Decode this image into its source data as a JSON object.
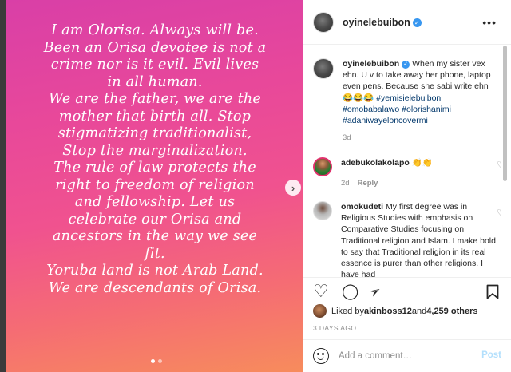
{
  "post": {
    "quote_lines": [
      "I am Olorisa. Always will be.",
      "Been an Orisa devotee is not a",
      "crime nor is it evil. Evil lives",
      "in all human.",
      "We are the father, we are the",
      "mother that birth all. Stop",
      "stigmatizing traditionalist,",
      "Stop the marginalization.",
      "The rule of law protects the",
      "right to freedom of religion",
      "and fellowship. Let us",
      "celebrate our Orisa and",
      "ancestors in the way we see",
      "fit.",
      "Yoruba land is not Arab Land.",
      "We are descendants of Orisa."
    ],
    "next_icon": "›",
    "carousel_index": 1,
    "carousel_count": 2
  },
  "header": {
    "username": "oyinelebuibon",
    "verified_icon": "✓",
    "more_icon": "•••"
  },
  "caption": {
    "username": "oyinelebuibon",
    "text": " When my sister vex ehn. U v to take away her phone, laptop even pens. Because she sabi write ehn 😂😂😂 ",
    "hashtags": "#yemisielebuibon #omobabalawo #olorishanimi #adaniwayeloncovermi",
    "age": "3d"
  },
  "comments": [
    {
      "username": "adebukolakolapo",
      "text": " 👏👏",
      "age": "2d",
      "reply_label": "Reply"
    },
    {
      "username": "omokudeti",
      "text": " My first degree was in Religious Studies with emphasis on Comparative Studies focusing on Traditional religion and Islam. I make bold to say that Traditional religion in its real essence is purer than other religions. I have had"
    }
  ],
  "icons": {
    "heart": "♡",
    "comment": "◯",
    "share": "➢",
    "save": "⌑"
  },
  "likes": {
    "prefix": "Liked by ",
    "user": "akinboss12",
    "middle": " and ",
    "count": "4,259 others"
  },
  "date": "3 DAYS AGO",
  "add_comment": {
    "placeholder": "Add a comment…",
    "post_label": "Post"
  },
  "colors": {
    "gradient_top": "#d93fa7",
    "gradient_bottom": "#f78c5c",
    "link": "#00376b",
    "verified": "#3897f0",
    "post_disabled": "#b2dffc"
  }
}
